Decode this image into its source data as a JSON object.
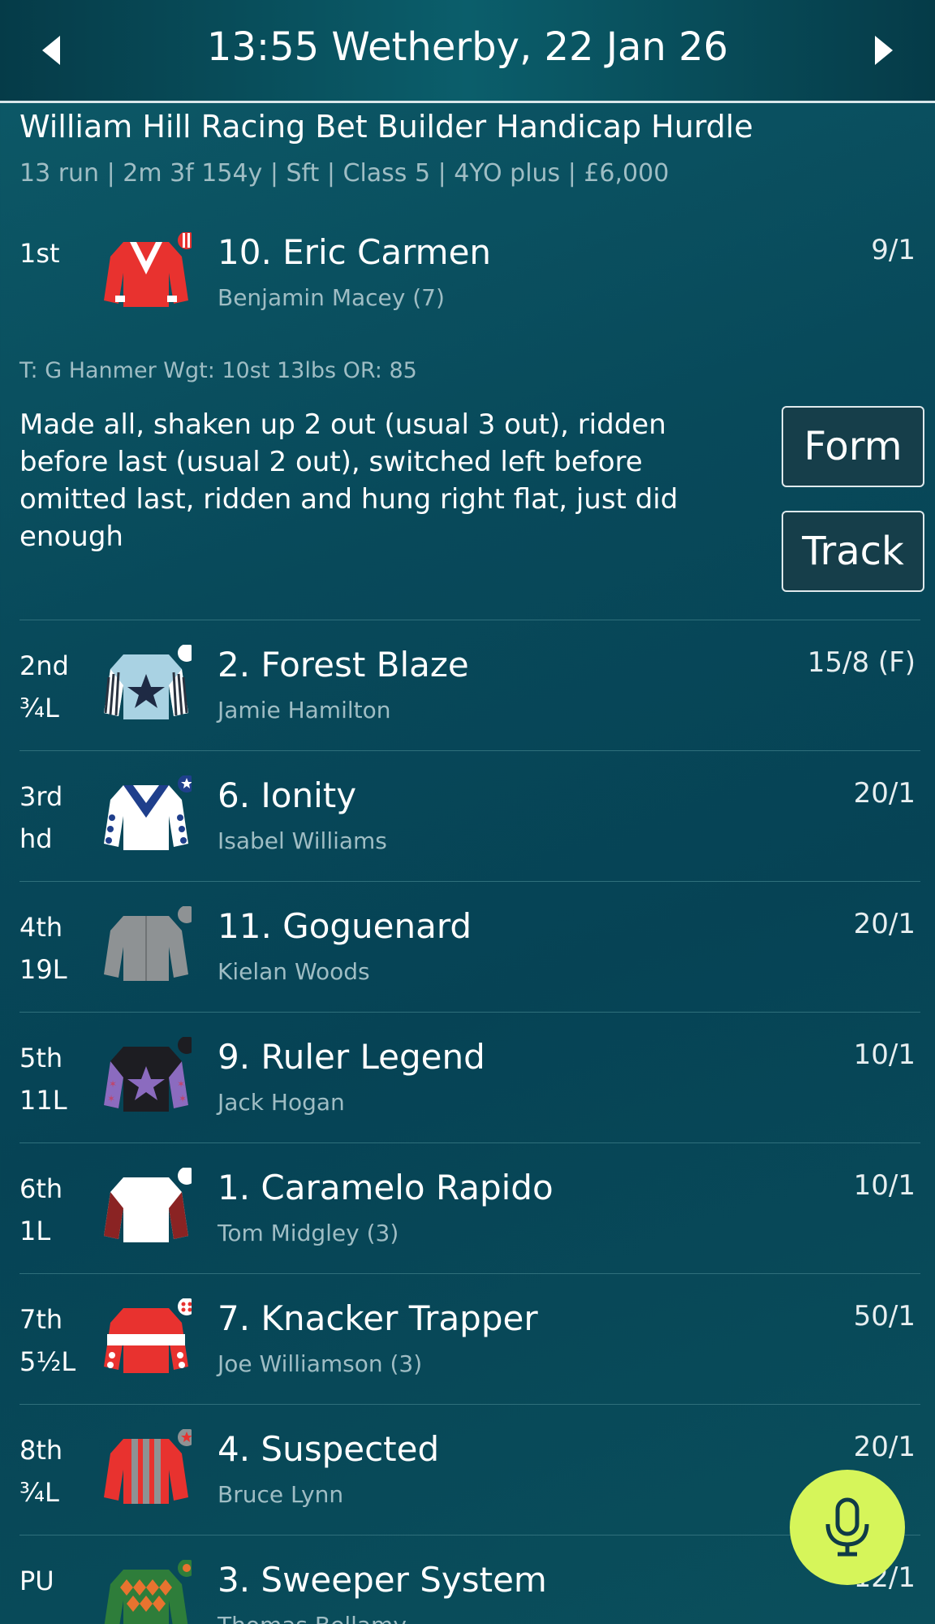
{
  "header": {
    "title": "13:55 Wetherby, 22 Jan 26"
  },
  "race": {
    "name": "William Hill Racing Bet Builder Handicap Hurdle",
    "info": "13 run | 2m 3f 154y | Sft | Class 5 | 4YO plus | £6,000"
  },
  "winner": {
    "position": "1st",
    "name": "10. Eric Carmen",
    "jockey": "Benjamin Macey (7)",
    "odds": "9/1",
    "meta": "T: G Hanmer  Wgt: 10st 13lbs  OR: 85",
    "comment": "Made all, shaken up 2 out (usual 3 out), ridden before last (usual 2 out), switched left before omitted last, ridden and hung right flat, just did enough",
    "form_label": "Form",
    "track_label": "Track"
  },
  "runners": [
    {
      "position": "2nd",
      "distance": "¾L",
      "name": "2. Forest Blaze",
      "jockey": "Jamie Hamilton",
      "odds": "15/8 (F)",
      "silk": "forest-blaze"
    },
    {
      "position": "3rd",
      "distance": "hd",
      "name": "6. Ionity",
      "jockey": "Isabel Williams",
      "odds": "20/1",
      "silk": "ionity"
    },
    {
      "position": "4th",
      "distance": "19L",
      "name": "11. Goguenard",
      "jockey": "Kielan Woods",
      "odds": "20/1",
      "silk": "goguenard"
    },
    {
      "position": "5th",
      "distance": "11L",
      "name": "9. Ruler Legend",
      "jockey": "Jack Hogan",
      "odds": "10/1",
      "silk": "ruler-legend"
    },
    {
      "position": "6th",
      "distance": "1L",
      "name": "1. Caramelo Rapido",
      "jockey": "Tom Midgley (3)",
      "odds": "10/1",
      "silk": "caramelo-rapido"
    },
    {
      "position": "7th",
      "distance": "5½L",
      "name": "7. Knacker Trapper",
      "jockey": "Joe Williamson (3)",
      "odds": "50/1",
      "silk": "knacker-trapper"
    },
    {
      "position": "8th",
      "distance": "¾L",
      "name": "4. Suspected",
      "jockey": "Bruce Lynn",
      "odds": "20/1",
      "silk": "suspected"
    },
    {
      "position": "PU",
      "distance": "",
      "name": "3. Sweeper System",
      "jockey": "Thomas Bellamy",
      "odds": "12/1",
      "silk": "sweeper-system"
    }
  ],
  "icons": {
    "prev": "chevron-left-icon",
    "next": "chevron-right-icon",
    "mic": "microphone-icon"
  },
  "colors": {
    "accent": "#d6f55a",
    "background": "#064355",
    "muted_text": "#9fbdc4"
  }
}
